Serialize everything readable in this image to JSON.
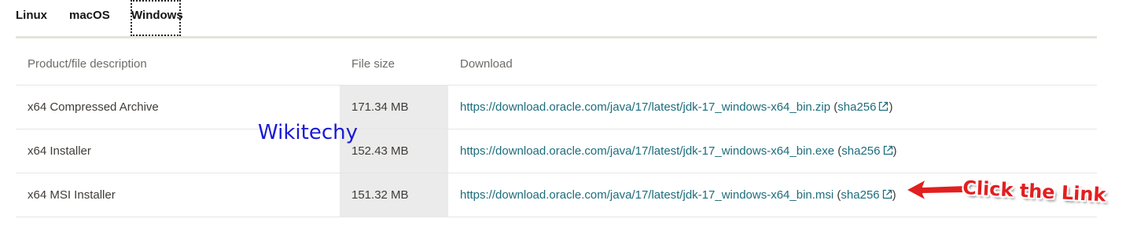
{
  "tabs": [
    {
      "label": "Linux"
    },
    {
      "label": "macOS"
    },
    {
      "label": "Windows",
      "selected": true
    }
  ],
  "table": {
    "headers": [
      "Product/file description",
      "File size",
      "Download"
    ],
    "rows": [
      {
        "description": "x64 Compressed Archive",
        "size": "171.34 MB",
        "url": "https://download.oracle.com/java/17/latest/jdk-17_windows-x64_bin.zip",
        "checksum": "sha256"
      },
      {
        "description": "x64 Installer",
        "size": "152.43 MB",
        "url": "https://download.oracle.com/java/17/latest/jdk-17_windows-x64_bin.exe",
        "checksum": "sha256"
      },
      {
        "description": "x64 MSI Installer",
        "size": "151.32 MB",
        "url": "https://download.oracle.com/java/17/latest/jdk-17_windows-x64_bin.msi",
        "checksum": "sha256"
      }
    ]
  },
  "watermark": "Wikitechy",
  "annotation": {
    "text": "Click the Link",
    "color": "#e21f1f"
  },
  "colors": {
    "link": "#1c6d7c",
    "size_column_bg": "#ebebeb",
    "tab_underline": "#e5e3dc"
  },
  "icons": {
    "external_link": "external-link-icon"
  }
}
